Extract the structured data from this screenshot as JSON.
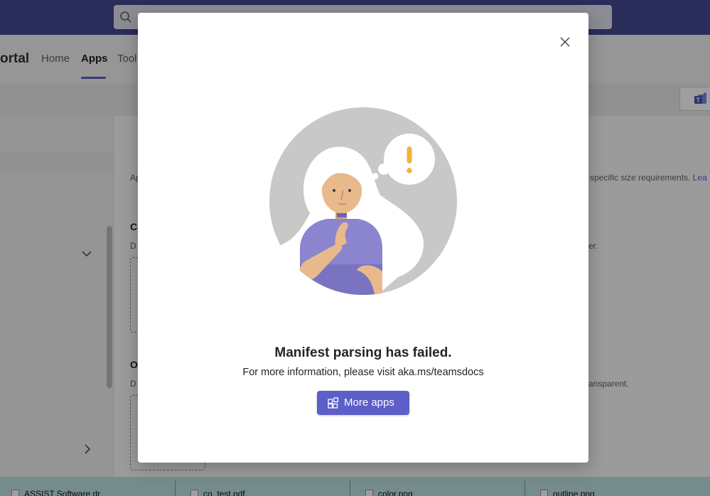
{
  "app": {
    "search": {
      "placeholder": ""
    },
    "brand": "ortal",
    "nav": [
      {
        "label": "Home"
      },
      {
        "label": "Apps"
      },
      {
        "label": "Tool"
      }
    ],
    "content": {
      "section_intro": "Ap",
      "size_note": "specific size requirements.",
      "learn_link": "Lea",
      "color_icon_heading": "Co",
      "color_icon_desc": "D",
      "color_icon_note": "er.",
      "outline_icon_heading": "O",
      "outline_icon_desc": "D",
      "outline_icon_note": "ansparent."
    },
    "taskbar": [
      {
        "label": "ASSIST Software dr"
      },
      {
        "label": "co_test.pdf"
      },
      {
        "label": "color.png"
      },
      {
        "label": "outline.png"
      }
    ]
  },
  "dialog": {
    "title": "Manifest parsing has failed.",
    "subtitle": "For more information, please visit aka.ms/teamsdocs",
    "button_label": "More apps",
    "icons": {
      "close": "close-icon",
      "button": "apps-icon",
      "illustration": "thinking-person-warning"
    },
    "colors": {
      "primary": "#5b5fc7",
      "warning": "#f2b33d",
      "header_bar": "#444791"
    }
  }
}
